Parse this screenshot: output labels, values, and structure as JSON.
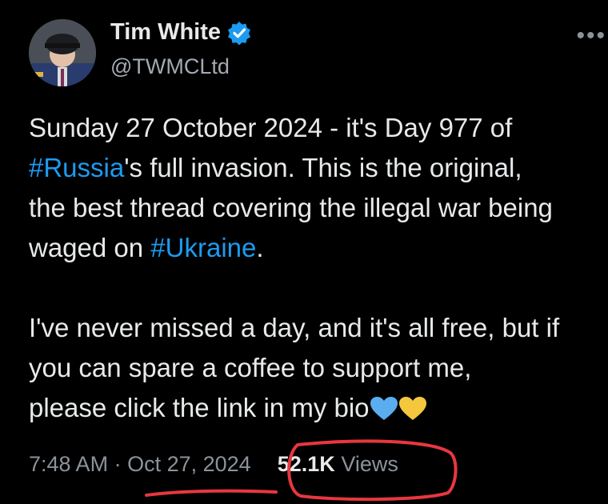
{
  "author": {
    "display_name": "Tim White",
    "handle": "@TWMCLtd",
    "verified_icon": "verified-badge-icon",
    "more_icon": "more-options-icon"
  },
  "tweet": {
    "line1": "Sunday 27 October 2024 - it's Day 977 of",
    "hashtag1": "#Russia",
    "line2_rest": "'s full invasion. This is the original,",
    "line3": "the best thread covering the illegal war being",
    "line4_pre": "waged on ",
    "hashtag2": "#Ukraine",
    "line4_post": ".",
    "line5": "I've never missed a day, and it's all free, but if",
    "line6": "you can spare a coffee to support me,",
    "line7": "please click the link in my bio",
    "emoji": [
      "blue-heart-icon",
      "yellow-heart-icon"
    ]
  },
  "meta": {
    "time": "7:48 AM",
    "separator": "·",
    "date": "Oct 27, 2024",
    "views_count": "52.1K",
    "views_label": "Views"
  },
  "colors": {
    "background": "#000000",
    "text": "#e7e9ea",
    "secondary": "#8b929a",
    "link": "#1d9bf0",
    "annotation": "#e8373f"
  }
}
